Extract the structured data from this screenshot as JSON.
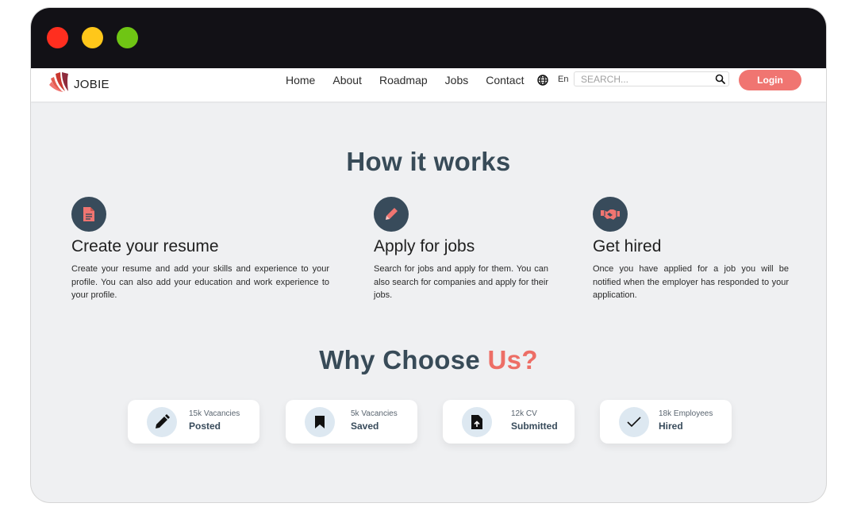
{
  "brand": {
    "name": "JOBIE",
    "accent": "#f07571",
    "dark": "#384b5b"
  },
  "nav": {
    "links": [
      "Home",
      "About",
      "Roadmap",
      "Jobs",
      "Contact"
    ],
    "language": "En",
    "search_placeholder": "SEARCH...",
    "login_label": "Login"
  },
  "how": {
    "title": "How it works",
    "steps": [
      {
        "icon": "document-icon",
        "title": "Create your resume",
        "desc": "Create your resume and add your skills and experience to your profile. You can also add your education and work experience to your profile."
      },
      {
        "icon": "pencil-icon",
        "title": "Apply for jobs",
        "desc": "Search for jobs and apply for them. You can also search for companies and apply for their jobs."
      },
      {
        "icon": "handshake-icon",
        "title": "Get hired",
        "desc": "Once you have applied for a job you will be notified when the employer has responded to your application."
      }
    ]
  },
  "why": {
    "title_main": "Why Choose ",
    "title_accent": "Us?",
    "stats": [
      {
        "icon": "pencil-icon",
        "top": "15k Vacancies",
        "bottom": "Posted"
      },
      {
        "icon": "bookmark-icon",
        "top": "5k Vacancies",
        "bottom": "Saved"
      },
      {
        "icon": "file-upload-icon",
        "top": "12k CV",
        "bottom": "Submitted"
      },
      {
        "icon": "checkmark-icon",
        "top": "18k Employees",
        "bottom": "Hired"
      }
    ]
  }
}
